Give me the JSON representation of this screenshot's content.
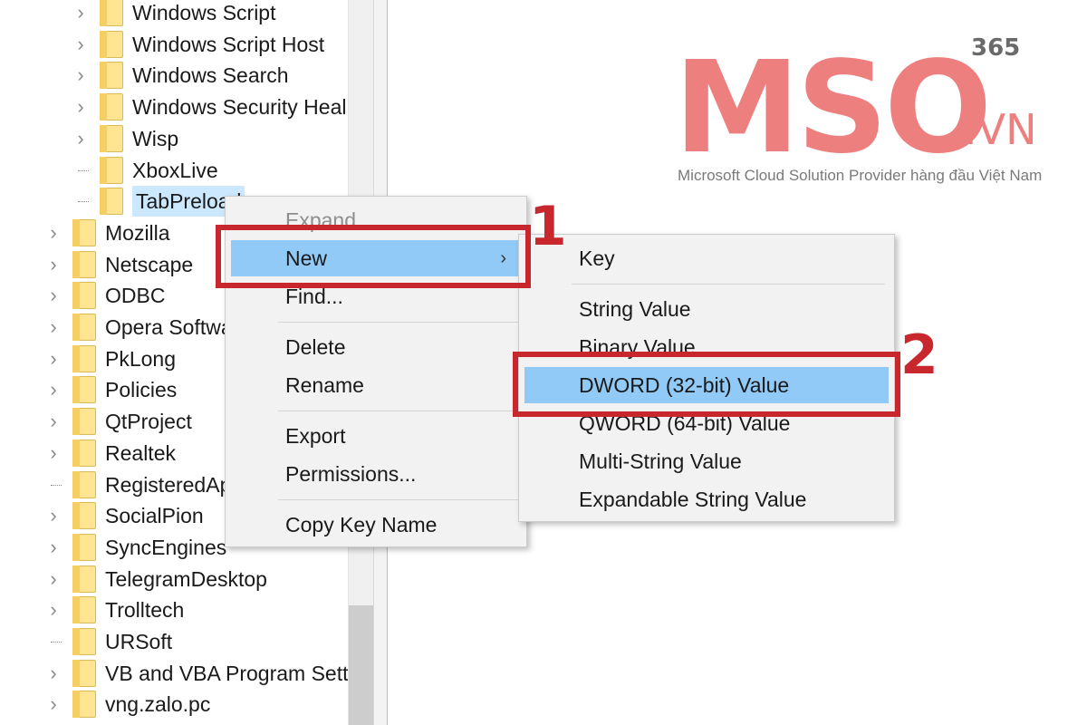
{
  "tree": {
    "items": [
      {
        "label": "Windows Script",
        "connector": "chevron"
      },
      {
        "label": "Windows Script Host",
        "connector": "chevron"
      },
      {
        "label": "Windows Search",
        "connector": "chevron"
      },
      {
        "label": "Windows Security Heal",
        "connector": "chevron"
      },
      {
        "label": "Wisp",
        "connector": "chevron"
      },
      {
        "label": "XboxLive",
        "connector": "line"
      },
      {
        "label": "TabPreload",
        "connector": "line",
        "selected": true
      },
      {
        "label": "Mozilla",
        "connector": "chevron"
      },
      {
        "label": "Netscape",
        "connector": "chevron"
      },
      {
        "label": "ODBC",
        "connector": "chevron"
      },
      {
        "label": "Opera Softwa",
        "connector": "chevron"
      },
      {
        "label": "PkLong",
        "connector": "chevron"
      },
      {
        "label": "Policies",
        "connector": "chevron"
      },
      {
        "label": "QtProject",
        "connector": "chevron"
      },
      {
        "label": "Realtek",
        "connector": "chevron"
      },
      {
        "label": "RegisteredAp",
        "connector": "line"
      },
      {
        "label": "SocialPion",
        "connector": "chevron"
      },
      {
        "label": "SyncEngines",
        "connector": "chevron"
      },
      {
        "label": "TelegramDesktop",
        "connector": "chevron"
      },
      {
        "label": "Trolltech",
        "connector": "chevron"
      },
      {
        "label": "URSoft",
        "connector": "line"
      },
      {
        "label": "VB and VBA Program Setti",
        "connector": "chevron"
      },
      {
        "label": "vng.zalo.pc",
        "connector": "chevron"
      }
    ]
  },
  "context_menu": {
    "expand": "Expand",
    "new": "New",
    "new_arrow": "›",
    "find": "Find...",
    "delete": "Delete",
    "rename": "Rename",
    "export": "Export",
    "permissions": "Permissions...",
    "copy_key_name": "Copy Key Name"
  },
  "submenu": {
    "key": "Key",
    "string_value": "String Value",
    "binary_value": "Binary Value",
    "dword_value": "DWORD (32-bit) Value",
    "qword_value": "QWORD (64-bit) Value",
    "multi_string_value": "Multi-String Value",
    "expandable_string_value": "Expandable String Value"
  },
  "annotations": {
    "step1": "1",
    "step2": "2",
    "color": "#c8282d"
  },
  "logo": {
    "main": "MSO",
    "domain": ".VN",
    "badge": "365",
    "tagline": "Microsoft Cloud Solution Provider hàng đầu Việt Nam",
    "color": "#ee7f7f"
  },
  "colors": {
    "highlight": "#91c9f7",
    "selection": "#cce8ff",
    "folder": "#ffe591"
  }
}
